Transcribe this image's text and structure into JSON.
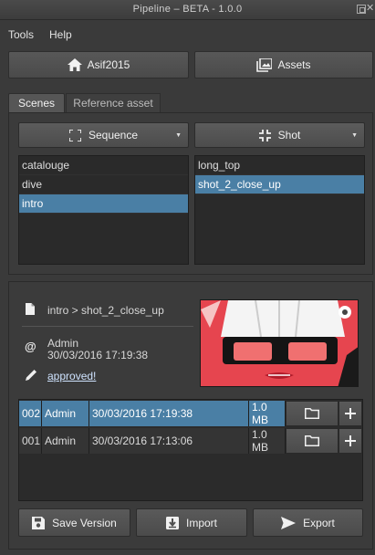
{
  "window": {
    "title": "Pipeline – BETA - 1.0.0"
  },
  "menu": {
    "items": [
      "Tools",
      "Help"
    ]
  },
  "nav": {
    "project_label": "Asif2015",
    "assets_label": "Assets"
  },
  "tabs": [
    {
      "label": "Scenes",
      "active": true
    },
    {
      "label": "Reference asset",
      "active": false
    }
  ],
  "sequence": {
    "dropdown_label": "Sequence",
    "items": [
      "catalouge",
      "dive",
      "intro"
    ],
    "selected": "intro"
  },
  "shot": {
    "dropdown_label": "Shot",
    "items": [
      "long_top",
      "shot_2_close_up"
    ],
    "selected": "shot_2_close_up"
  },
  "info": {
    "path": "intro > shot_2_close_up",
    "user": "Admin",
    "datetime": "30/03/2016 17:19:38",
    "status": "approved!"
  },
  "versions": [
    {
      "version": "002",
      "user": "Admin",
      "date": "30/03/2016 17:19:38",
      "size": "1.0 MB",
      "selected": true
    },
    {
      "version": "001",
      "user": "Admin",
      "date": "30/03/2016 17:13:06",
      "size": "1.0 MB",
      "selected": false
    }
  ],
  "actions": {
    "save_label": "Save Version",
    "import_label": "Import",
    "export_label": "Export"
  },
  "colors": {
    "selection": "#4a7fa5",
    "background": "#3a3a3a",
    "thumbnail": "#e6454f"
  }
}
